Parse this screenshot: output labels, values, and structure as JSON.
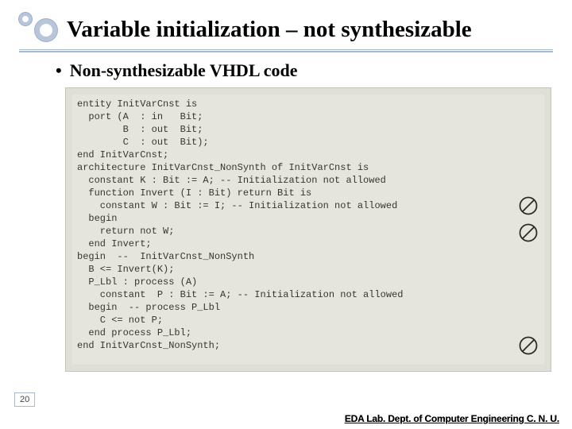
{
  "title": "Variable initialization – not synthesizable",
  "bullet": "Non-synthesizable VHDL code",
  "page_number": "20",
  "dept": "EDA Lab. Dept. of Computer Engineering C. N. U.",
  "code": {
    "l01": "entity InitVarCnst is",
    "l02": "  port (A  : in   Bit;",
    "l03": "        B  : out  Bit;",
    "l04": "        C  : out  Bit);",
    "l05": "",
    "l06": "end InitVarCnst;",
    "l07": "",
    "l08": "architecture InitVarCnst_NonSynth of InitVarCnst is",
    "l09": "  constant K : Bit := A; -- Initialization not allowed",
    "l10": "  function Invert (I : Bit) return Bit is",
    "l11": "    constant W : Bit := I; -- Initialization not allowed",
    "l12": "  begin",
    "l13": "    return not W;",
    "l14": "  end Invert;",
    "l15": "",
    "l16": "begin  --  InitVarCnst_NonSynth",
    "l17": "  B <= Invert(K);",
    "l18": "",
    "l19": "  P_Lbl : process (A)",
    "l20": "    constant  P : Bit := A; -- Initialization not allowed",
    "l21": "  begin  -- process P_Lbl",
    "l22": "    C <= not P;",
    "l23": "  end process P_Lbl;",
    "l24": "end InitVarCnst_NonSynth;"
  },
  "icons": {
    "prohibit_name": "prohibit-icon"
  }
}
